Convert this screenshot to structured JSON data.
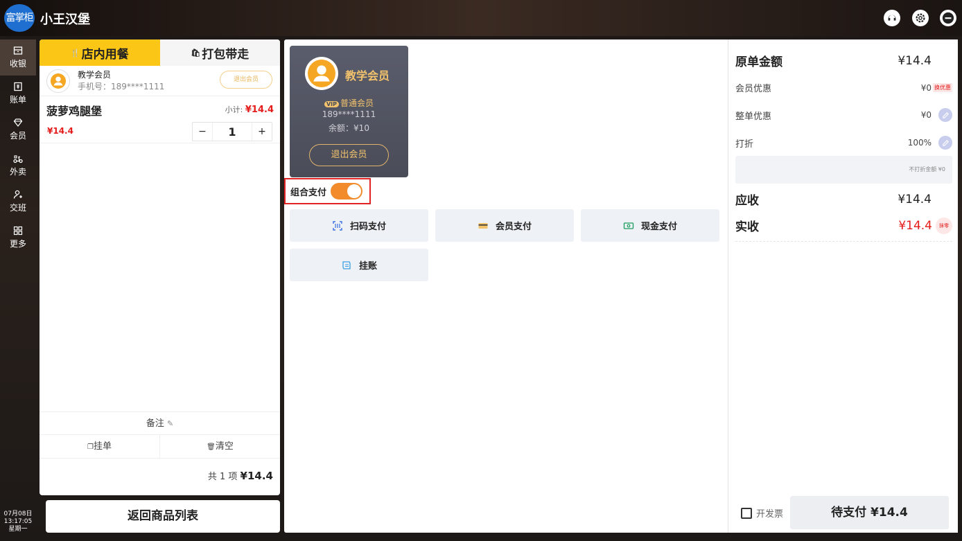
{
  "app": {
    "logo_text": "富掌柜",
    "store_name": "小王汉堡"
  },
  "nav": {
    "items": [
      {
        "label": "收银",
        "icon": "register-icon",
        "active": true
      },
      {
        "label": "账单",
        "icon": "bill-icon"
      },
      {
        "label": "会员",
        "icon": "diamond-icon"
      },
      {
        "label": "外卖",
        "icon": "scooter-icon"
      },
      {
        "label": "交班",
        "icon": "handover-icon"
      },
      {
        "label": "更多",
        "icon": "grid-icon"
      }
    ],
    "date": "07月08日",
    "time": "13:17:05",
    "weekday": "星期一"
  },
  "order": {
    "tabs": [
      {
        "label": "店内用餐",
        "active": true
      },
      {
        "label": "打包带走",
        "active": false
      }
    ],
    "member": {
      "name": "教学会员",
      "phone": "手机号：189****1111",
      "exit_label": "退出会员"
    },
    "item": {
      "name": "菠萝鸡腿堡",
      "subtotal_label": "小计:",
      "subtotal": "¥14.4",
      "price": "¥14.4",
      "qty": "1",
      "minus": "−",
      "plus": "+"
    },
    "note_label": "备注",
    "hold_label": "挂单",
    "clear_label": "清空",
    "count_label": "共 1 项",
    "total": "¥14.4"
  },
  "back_label": "返回商品列表",
  "member_card": {
    "name": "教学会员",
    "vip_tag": "VIP",
    "level": "普通会员",
    "phone": "189****1111",
    "balance": "余额：¥10",
    "exit_label": "退出会员"
  },
  "combo_pay": {
    "label": "组合支付",
    "enabled": true,
    "toggle_color": "#f28b2b"
  },
  "pay_methods": [
    {
      "label": "扫码支付",
      "icon": "scan-icon"
    },
    {
      "label": "会员支付",
      "icon": "member-card-icon"
    },
    {
      "label": "现金支付",
      "icon": "cash-icon"
    },
    {
      "label": "挂账",
      "icon": "ledger-icon"
    }
  ],
  "summary": {
    "original_label": "原单金额",
    "original_value": "¥14.4",
    "member_disc_label": "会员优惠",
    "member_disc_value": "¥0",
    "member_disc_tag": "换优惠",
    "order_disc_label": "整单优惠",
    "order_disc_value": "¥0",
    "discount_label": "打折",
    "discount_value": "100%",
    "no_discount_text": "不打折金额 ¥0",
    "due_label": "应收",
    "due_value": "¥14.4",
    "paid_label": "实收",
    "paid_value": "¥14.4",
    "round_tag": "抹零",
    "invoice_label": "开发票",
    "pending_label": "待支付 ¥14.4"
  },
  "colors": {
    "accent": "#fbc615",
    "price_red": "#e51c1c",
    "card_gold": "#f2c36c",
    "highlight_border": "#e02424"
  }
}
